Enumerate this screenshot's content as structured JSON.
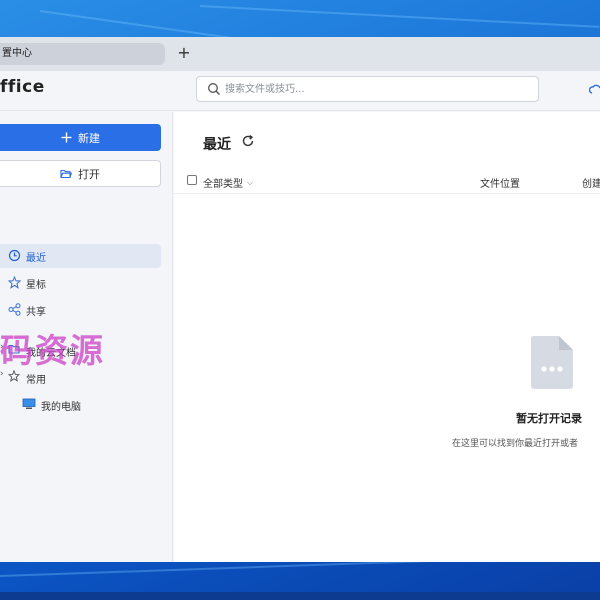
{
  "tab": {
    "title": "置中心",
    "add_label": "+"
  },
  "app": {
    "brand": "ffice"
  },
  "search": {
    "placeholder": "搜索文件或技巧..."
  },
  "sidebar": {
    "new_label": "新建",
    "open_label": "打开",
    "nav": [
      {
        "label": "最近",
        "icon": "clock-icon"
      },
      {
        "label": "星标",
        "icon": "star-icon"
      },
      {
        "label": "共享",
        "icon": "share-icon"
      }
    ],
    "tree": [
      {
        "label": "我的云文档",
        "icon": "folder-icon"
      },
      {
        "label": "常用",
        "icon": "star-icon"
      },
      {
        "label": "我的电脑",
        "icon": "computer-icon"
      }
    ]
  },
  "watermark": "码资源",
  "main": {
    "title": "最近",
    "columns": {
      "type": "全部类型",
      "location": "文件位置",
      "created": "创建"
    },
    "empty_title": "暂无打开记录",
    "empty_subtitle": "在这里可以找到你最近打开或者"
  },
  "colors": {
    "accent": "#2b6fe6",
    "active_bg": "#e1e8f3"
  }
}
